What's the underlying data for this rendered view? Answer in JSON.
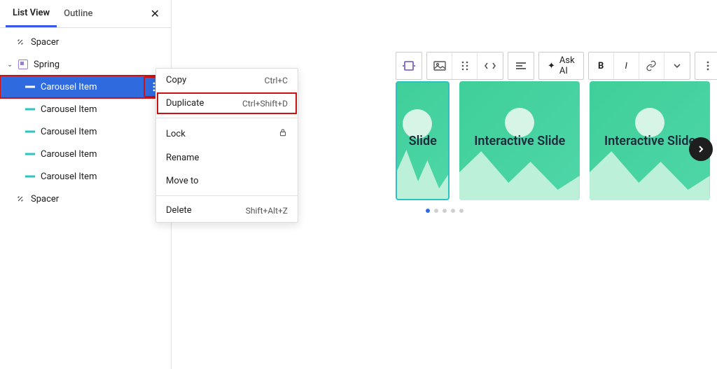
{
  "tabs": {
    "list_view": "List View",
    "outline": "Outline"
  },
  "tree": {
    "spacer1": "Spacer",
    "spring": "Spring",
    "carousel_items": [
      "Carousel Item",
      "Carousel Item",
      "Carousel Item",
      "Carousel Item",
      "Carousel Item"
    ],
    "spacer2": "Spacer"
  },
  "ctx": {
    "copy": "Copy",
    "copy_sc": "Ctrl+C",
    "duplicate": "Duplicate",
    "duplicate_sc": "Ctrl+Shift+D",
    "lock": "Lock",
    "rename": "Rename",
    "moveto": "Move to",
    "delete": "Delete",
    "delete_sc": "Shift+Alt+Z"
  },
  "toolbar": {
    "ask_ai": "Ask AI"
  },
  "slides": {
    "caption1": "Slide",
    "caption2": "Interactive Slide",
    "caption3": "Interactive Slide"
  },
  "dots_count": 5,
  "active_dot": 0
}
